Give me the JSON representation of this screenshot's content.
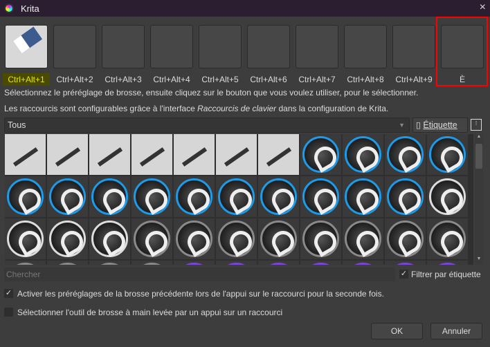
{
  "window": {
    "title": "Krita",
    "close_icon": "×"
  },
  "presets": [
    {
      "label": "Ctrl+Alt+1",
      "has_image": true,
      "active": true
    },
    {
      "label": "Ctrl+Alt+2"
    },
    {
      "label": "Ctrl+Alt+3"
    },
    {
      "label": "Ctrl+Alt+4"
    },
    {
      "label": "Ctrl+Alt+5"
    },
    {
      "label": "Ctrl+Alt+6"
    },
    {
      "label": "Ctrl+Alt+7"
    },
    {
      "label": "Ctrl+Alt+8"
    },
    {
      "label": "Ctrl+Alt+9"
    },
    {
      "label": "È"
    }
  ],
  "info": {
    "line1": "Sélectionnez le préréglage de brosse, ensuite cliquez sur le bouton que vous voulez utiliser, pour le sélectionner.",
    "line2_pre": "Les raccourcis sont configurables grâce à l'interface ",
    "line2_em": "Raccourcis de clavier",
    "line2_post": " dans la configuration de Krita."
  },
  "filter": {
    "combo_value": "Tous",
    "tag_button": "Étiquette",
    "tag_icon": "bookmark-icon",
    "menu_icon": "⁝"
  },
  "brushes": {
    "rows": [
      [
        "pen",
        "pen",
        "pen",
        "pen",
        "pen",
        "pen",
        "pen",
        "#1e9be8",
        "#1e9be8",
        "#1e9be8",
        "#1e9be8"
      ],
      [
        "#1e9be8",
        "#1e9be8",
        "#1e9be8",
        "#1e9be8",
        "#1e9be8",
        "#1e9be8",
        "#1e9be8",
        "#1e9be8",
        "#1e9be8",
        "#1e9be8",
        "#dddddd"
      ],
      [
        "#dddddd",
        "#dddddd",
        "#dddddd",
        "#8a8a8a",
        "#8a8a8a",
        "#8a8a8a",
        "#8a8a8a",
        "#8a8a8a",
        "#8a8a8a",
        "#8a8a8a",
        "#8a8a8a"
      ],
      [
        "#8a8a8a",
        "#8a8a8a",
        "#8a8a8a",
        "#8a8a8a",
        "#7a45d8",
        "#7a45d8",
        "#7a45d8",
        "#7a45d8",
        "#7a45d8",
        "#7a45d8",
        "#7a45d8"
      ]
    ]
  },
  "search": {
    "placeholder": "Chercher",
    "filter_by_tag": "Filtrer par étiquette",
    "filter_checked": true
  },
  "options": {
    "activate_previous": "Activer les préréglages de la brosse précédente lors de l'appui sur le raccourci pour la seconde fois.",
    "activate_previous_checked": true,
    "select_freehand": "Sélectionner l'outil de brosse à main levée par un appui sur un raccourci",
    "select_freehand_checked": false
  },
  "buttons": {
    "ok": "OK",
    "cancel": "Annuler"
  }
}
